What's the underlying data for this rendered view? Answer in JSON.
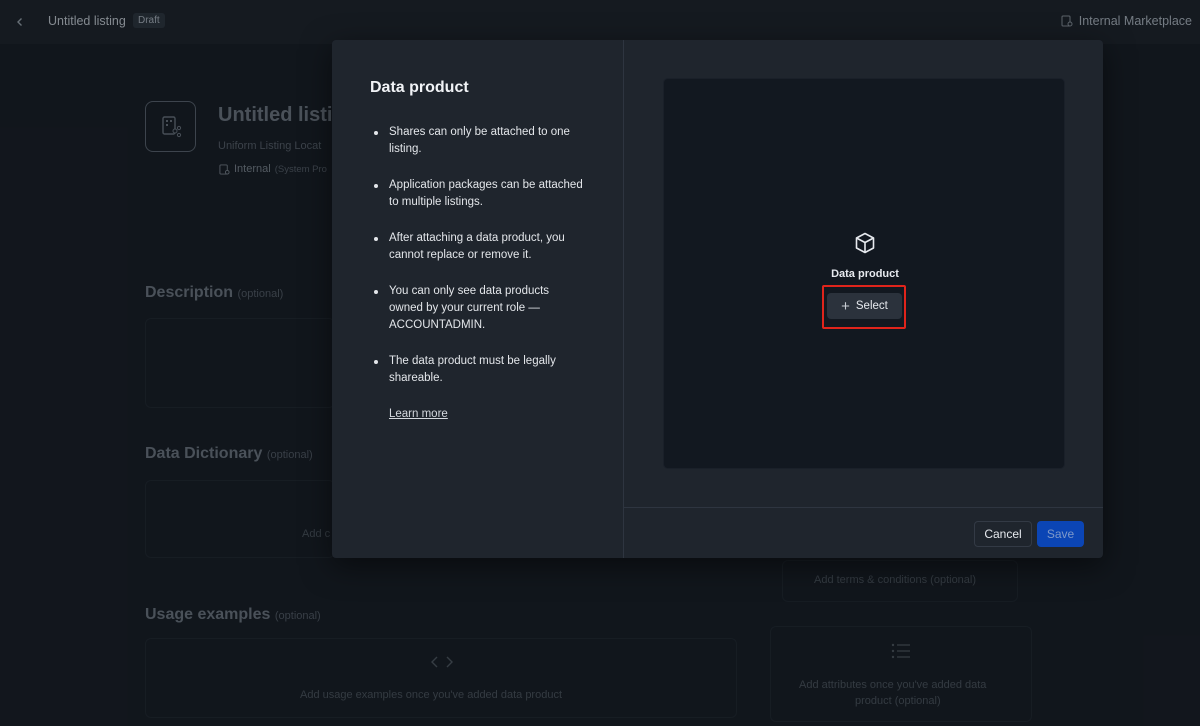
{
  "topbar": {
    "title": "Untitled listing",
    "badge": "Draft",
    "marketplace": "Internal Marketplace"
  },
  "background": {
    "listing_title": "Untitled listi",
    "listing_subtitle": "Uniform Listing Locat",
    "visibility": "Internal",
    "visibility_note": "(System Pro",
    "sections": [
      {
        "title": "Description",
        "optional": "(optional)"
      },
      {
        "title": "Data Dictionary",
        "optional": "(optional)"
      },
      {
        "title": "Usage examples",
        "optional": "(optional)"
      }
    ],
    "placeholders": {
      "dictionary": "Add c",
      "terms": "Add terms & conditions (optional)",
      "usage": "Add usage examples once you've added data product",
      "attributes_line1": "Add attributes once you've added data",
      "attributes_line2": "product (optional)"
    }
  },
  "modal": {
    "title": "Data product",
    "bullets": [
      "Shares can only be attached to one listing.",
      "Application packages can be attached to multiple listings.",
      "After attaching a data product, you cannot replace or remove it.",
      "You can only see data products owned by your current role — ACCOUNTADMIN.",
      "The data product must be legally shareable."
    ],
    "learn_more": "Learn more",
    "drop_label": "Data product",
    "select_label": "Select",
    "cancel_label": "Cancel",
    "save_label": "Save"
  },
  "colors": {
    "accent": "#0b45b5",
    "highlight": "#e0241b",
    "modal_bg": "#1f252d",
    "drop_bg": "#121820"
  },
  "icons": [
    "chevron-left-icon",
    "listing-share-icon",
    "cube-icon",
    "plus-icon",
    "code-icon",
    "list-icon"
  ]
}
